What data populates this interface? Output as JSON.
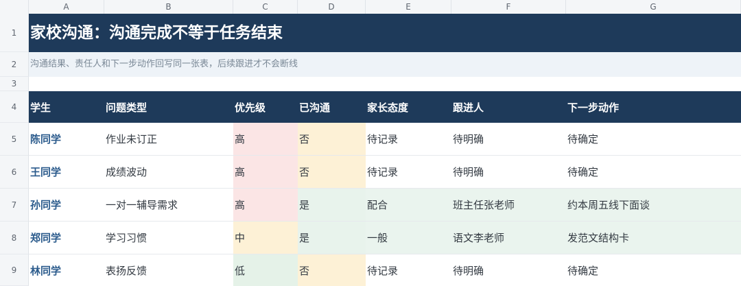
{
  "columns": [
    "A",
    "B",
    "C",
    "D",
    "E",
    "F",
    "G"
  ],
  "row_numbers": [
    "1",
    "2",
    "3",
    "4",
    "5",
    "6",
    "7",
    "8",
    "9"
  ],
  "title": "家校沟通：沟通完成不等于任务结束",
  "subtitle": "沟通结果、责任人和下一步动作回写同一张表，后续跟进才不会断线",
  "headers": {
    "student": "学生",
    "issue": "问题类型",
    "priority": "优先级",
    "contacted": "已沟通",
    "attitude": "家长态度",
    "follower": "跟进人",
    "next": "下一步动作"
  },
  "rows": [
    {
      "student": "陈同学",
      "issue": "作业未订正",
      "priority": "高",
      "contacted": "否",
      "attitude": "待记录",
      "follower": "待明确",
      "next": "待确定"
    },
    {
      "student": "王同学",
      "issue": "成绩波动",
      "priority": "高",
      "contacted": "否",
      "attitude": "待记录",
      "follower": "待明确",
      "next": "待确定"
    },
    {
      "student": "孙同学",
      "issue": "一对一辅导需求",
      "priority": "高",
      "contacted": "是",
      "attitude": "配合",
      "follower": "班主任张老师",
      "next": "约本周五线下面谈"
    },
    {
      "student": "郑同学",
      "issue": "学习习惯",
      "priority": "中",
      "contacted": "是",
      "attitude": "一般",
      "follower": "语文李老师",
      "next": "发范文结构卡"
    },
    {
      "student": "林同学",
      "issue": "表扬反馈",
      "priority": "低",
      "contacted": "否",
      "attitude": "待记录",
      "follower": "待明确",
      "next": "待确定"
    }
  ],
  "colors": {
    "header_bg": "#1e3a5a",
    "student_name": "#2b5b8c",
    "priority_high": "#fbe5e5",
    "priority_mid": "#fdf1d6",
    "priority_low": "#e5f2e8",
    "contacted_yes": "#e8f3ec",
    "contacted_no": "#fdf1d6"
  }
}
